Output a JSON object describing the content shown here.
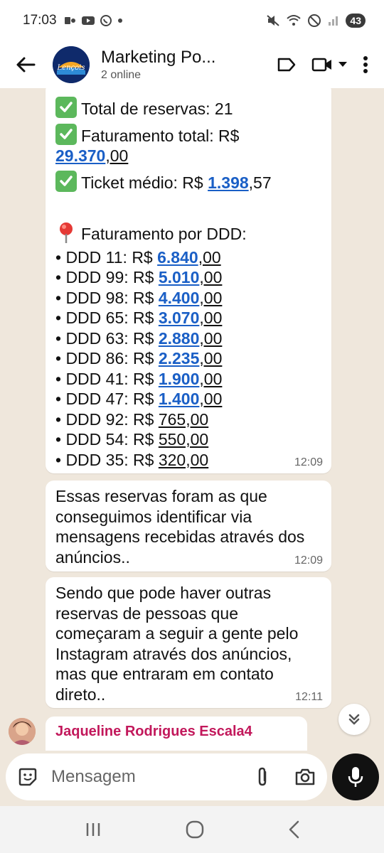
{
  "status_bar": {
    "time": "17:03",
    "battery": "43"
  },
  "header": {
    "title": "Marketing Po...",
    "subtitle": "2 online",
    "avatar_text": "Lençois"
  },
  "messages": {
    "stats": {
      "total_reservas": "Total de reservas: 21",
      "faturamento_prefix": "Faturamento total: R$",
      "faturamento_link": "29.370",
      "faturamento_suffix": ",00",
      "ticket_prefix": "Ticket médio: R$ ",
      "ticket_link": "1.398",
      "ticket_suffix": ",57",
      "ddd_header": "Faturamento por DDD:",
      "ddd_rows": [
        {
          "label": "• DDD 11: R$ ",
          "link": "6.840",
          "suffix": ",00"
        },
        {
          "label": "• DDD 99: R$ ",
          "link": "5.010",
          "suffix": ",00"
        },
        {
          "label": "• DDD 98: R$ ",
          "link": "4.400",
          "suffix": ",00"
        },
        {
          "label": "• DDD 65: R$ ",
          "link": "3.070",
          "suffix": ",00"
        },
        {
          "label": "• DDD 63: R$ ",
          "link": "2.880",
          "suffix": ",00"
        },
        {
          "label": "• DDD 86: R$ ",
          "link": "2.235",
          "suffix": ",00"
        },
        {
          "label": "• DDD 41: R$ ",
          "link": "1.900",
          "suffix": ",00"
        },
        {
          "label": "• DDD 47: R$ ",
          "link": "1.400",
          "suffix": ",00"
        },
        {
          "label": "• DDD 92: R$ ",
          "plain": "765,00"
        },
        {
          "label": "• DDD 54: R$ ",
          "plain": "550,00"
        },
        {
          "label": "• DDD 35: R$ ",
          "plain": "320,00"
        }
      ],
      "time": "12:09"
    },
    "msg2": {
      "lines": [
        "Essas reservas foram as que",
        "conseguimos identificar via",
        "mensagens recebidas através dos",
        "anúncios.."
      ],
      "time": "12:09"
    },
    "msg3": {
      "lines": [
        "Sendo que pode haver outras",
        "reservas de pessoas que",
        "começaram a seguir a gente pelo",
        "Instagram através dos anúncios,",
        "mas que entraram em contato",
        "direto.."
      ],
      "time": "12:11"
    },
    "next_sender": "Jaqueline Rodrigues Escala4"
  },
  "input": {
    "placeholder": "Mensagem"
  },
  "colors": {
    "link": "#1a5fc6",
    "chat_bg": "#efe7dc",
    "sender_name": "#c2185b",
    "check": "#5cb85c"
  },
  "icons": [
    "back-arrow-icon",
    "label-icon",
    "video-call-icon",
    "dropdown-icon",
    "more-vert-icon",
    "sticker-icon",
    "attach-icon",
    "camera-icon",
    "mic-icon",
    "scroll-down-icon"
  ]
}
